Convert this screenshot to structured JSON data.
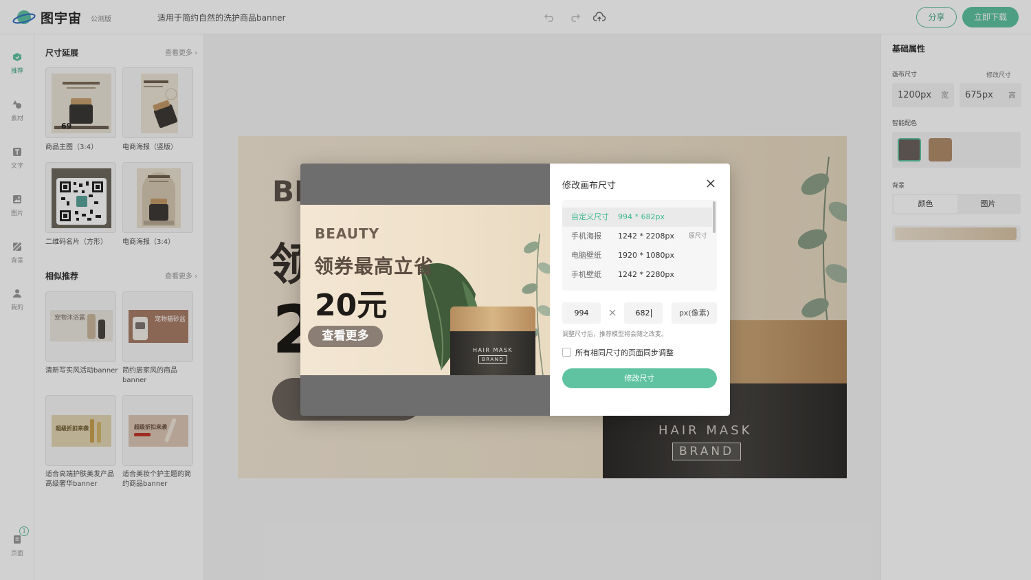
{
  "header": {
    "brand": "图宇宙",
    "edition": "公测版",
    "doc_title": "适用于简约自然的洗护商品banner",
    "share_label": "分享",
    "download_label": "立即下载",
    "icons": [
      "undo-icon",
      "redo-icon",
      "cloud-upload-icon"
    ]
  },
  "rail": {
    "items": [
      {
        "label": "推荐",
        "icon": "recommend-icon",
        "active": true
      },
      {
        "label": "素材",
        "icon": "shapes-icon"
      },
      {
        "label": "文字",
        "icon": "text-icon"
      },
      {
        "label": "图片",
        "icon": "image-icon"
      },
      {
        "label": "背景",
        "icon": "background-icon"
      },
      {
        "label": "我的",
        "icon": "user-icon"
      }
    ],
    "pages_label": "页面",
    "pages_count": "1"
  },
  "left_panel": {
    "size_section": {
      "title": "尺寸延展",
      "more": "查看更多",
      "cards": [
        {
          "label": "商品主图（3:4）",
          "badge": "69"
        },
        {
          "label": "电商海报（竖版）"
        },
        {
          "label": "二维码名片（方形）"
        },
        {
          "label": "电商海报（3:4）"
        }
      ]
    },
    "similar_section": {
      "title": "相似推荐",
      "more": "查看更多",
      "cards": [
        {
          "label": "清新写实风活动banner",
          "thumb_text": "宠物沐浴露"
        },
        {
          "label": "简约居家风的商品banner",
          "thumb_text": "宠物猫砂盆"
        },
        {
          "label": "适合高端护肤美发产品高级奢华banner",
          "thumb_text": "超级折扣来袭"
        },
        {
          "label": "适合美妆个护主题的简约商品banner",
          "thumb_text": "超级折扣来袭"
        }
      ]
    }
  },
  "canvas": {
    "beauty_partial": "BE",
    "headline_partial": "领",
    "price_partial": "2",
    "product_line1": "HAIR MASK",
    "product_line2": "BRAND"
  },
  "right_panel": {
    "title": "基础属性",
    "canvas_size_label": "画布尺寸",
    "modify_size_link": "修改尺寸",
    "width_value": "1200px",
    "width_unit": "宽",
    "height_value": "675px",
    "height_unit": "高",
    "smart_color_label": "智能配色",
    "swatches": [
      "#6b625d",
      "#b18e6c"
    ],
    "background_label": "背景",
    "bg_tab_color": "颜色",
    "bg_tab_image": "图片"
  },
  "modal": {
    "title": "修改画布尺寸",
    "preview": {
      "beauty": "BEAUTY",
      "headline": "领券最高立省",
      "price": "20元",
      "button": "查看更多",
      "product_line1": "HAIR MASK",
      "product_line2": "BRAND"
    },
    "sizes": [
      {
        "name": "自定义尺寸",
        "dim": "994 * 682px",
        "selected": true,
        "tag": ""
      },
      {
        "name": "手机海报",
        "dim": "1242 * 2208px",
        "tag": "原尺寸"
      },
      {
        "name": "电脑壁纸",
        "dim": "1920 * 1080px",
        "tag": ""
      },
      {
        "name": "手机壁纸",
        "dim": "1242 * 2280px",
        "tag": ""
      }
    ],
    "width_input": "994",
    "height_input": "682",
    "unit": "px(像素)",
    "hint": "调整尺寸后，推荐模型将会随之改变。",
    "sync_checkbox_label": "所有相同尺寸的页面同步调整",
    "sync_checked": false,
    "submit_label": "修改尺寸"
  },
  "colors": {
    "accent": "#5fc3a1",
    "accent_text": "#3fb98f"
  }
}
